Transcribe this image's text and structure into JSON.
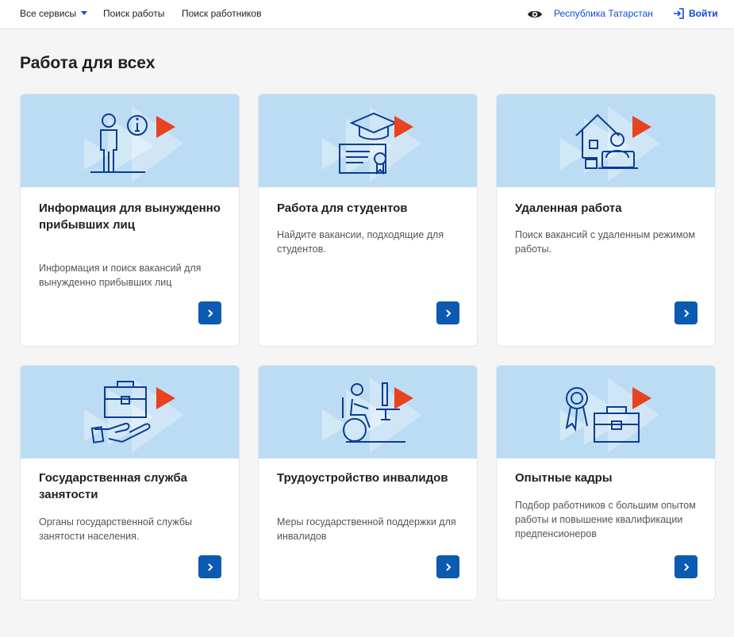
{
  "topbar": {
    "all_services": "Все сервисы",
    "job_search": "Поиск работы",
    "worker_search": "Поиск работников",
    "eye_icon": "eye-icon",
    "region": "Республика Татарстан",
    "login": "Войти",
    "login_icon": "login-icon"
  },
  "page": {
    "title": "Работа для всех"
  },
  "cards": [
    {
      "title": "Информация для вынужденно прибывших лиц",
      "description": "Информация и поиск вакансий для вынужденно прибывших лиц",
      "illustration": "person-info-illustration"
    },
    {
      "title": "Работа для студентов",
      "description": "Найдите вакансии, подходящие для студентов.",
      "illustration": "graduation-diploma-illustration"
    },
    {
      "title": "Удаленная работа",
      "description": "Поиск вакансий с удаленным режимом работы.",
      "illustration": "home-laptop-illustration"
    },
    {
      "title": "Государственная служба занятости",
      "description": "Органы государственной службы занятости населения.",
      "illustration": "briefcase-hand-illustration"
    },
    {
      "title": "Трудоустройство инвалидов",
      "description": "Меры государственной поддержки для инвалидов",
      "illustration": "wheelchair-desk-illustration"
    },
    {
      "title": "Опытные кадры",
      "description": "Подбор работников с большим опытом работы и повышение квалификации предпенсионеров",
      "illustration": "medal-briefcase-illustration"
    }
  ],
  "colors": {
    "accent": "#0d4cd3",
    "button": "#0d5ab3",
    "card_header": "#bcdcf3",
    "play_red": "#e8431f",
    "line_blue": "#0b3d91"
  }
}
